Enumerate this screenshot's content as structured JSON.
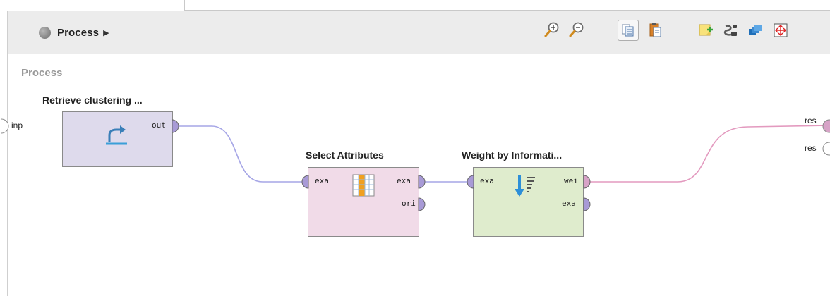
{
  "breadcrumb": {
    "label": "Process",
    "arrow": "▶"
  },
  "toolbar": {
    "icons": [
      "zoom-in-icon",
      "zoom-out-icon",
      "copy-icon",
      "paste-icon",
      "add-note-icon",
      "auto-wire-icon",
      "arrange-icon",
      "fit-icon"
    ]
  },
  "canvas": {
    "title": "Process"
  },
  "process_ports": {
    "input": "inp",
    "outputs": [
      "res",
      "res"
    ]
  },
  "operators": [
    {
      "title": "Retrieve clustering ...",
      "color": "#dedaec",
      "inputs": [],
      "outputs": [
        "out"
      ]
    },
    {
      "title": "Select Attributes",
      "color": "#f1dbe8",
      "inputs": [
        "exa"
      ],
      "outputs": [
        "exa",
        "ori"
      ]
    },
    {
      "title": "Weight by Informati...",
      "color": "#dfeccd",
      "inputs": [
        "exa"
      ],
      "outputs": [
        "wei",
        "exa"
      ]
    }
  ],
  "colors": {
    "example_set_wire": "#a6a6e6",
    "weights_wire": "#e39abf",
    "port_purple": "#a89ad6",
    "port_pink": "#d7a3c7"
  }
}
